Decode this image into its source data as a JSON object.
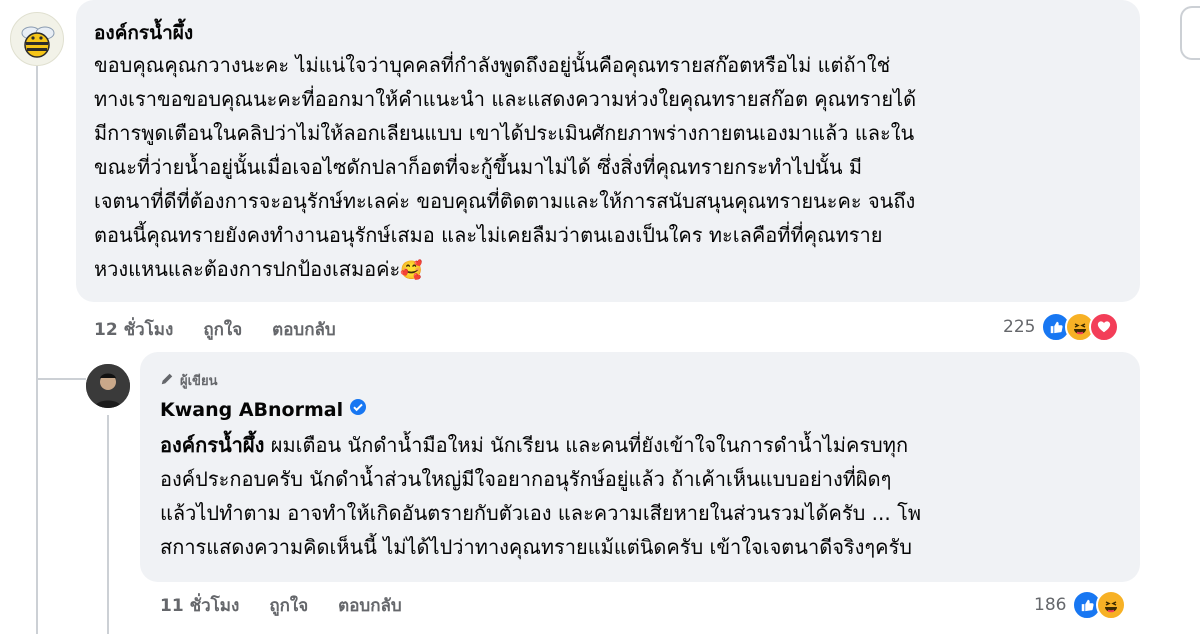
{
  "comment": {
    "author": "องค์กรน้ำผึ้ง",
    "lines": [
      "ขอบคุณคุณกวางนะคะ ไม่แน่ใจว่าบุคคลที่กำลังพูดถึงอยู่นั้นคือคุณทรายสก๊อตหรือไม่ แต่ถ้าใช่",
      "ทางเราขอขอบคุณนะคะที่ออกมาให้คำแนะนำ และแสดงความห่วงใยคุณทรายสก๊อต คุณทรายได้",
      "มีการพูดเตือนในคลิปว่าไม่ให้ลอกเลียนแบบ เขาได้ประเมินศักยภาพร่างกายตนเองมาแล้ว และใน",
      "ขณะที่ว่ายน้ำอยู่นั้นเมื่อเจอไซดักปลาก็อตที่จะกู้ขึ้นมาไม่ได้ ซึ่งสิ่งที่คุณทรายกระทำไปนั้น มี",
      "เจตนาที่ดีที่ต้องการจะอนุรักษ์ทะเลค่ะ ขอบคุณที่ติดตามและให้การสนับสนุนคุณทรายนะคะ จนถึง",
      "ตอนนี้คุณทรายยังคงทำงานอนุรักษ์เสมอ และไม่เคยลืมว่าตนเองเป็นใคร ทะเลคือที่ที่คุณทราย",
      "หวงแหนและต้องการปกป้องเสมอค่ะ"
    ],
    "trailing_emoji": "🥰",
    "time": "12 ชั่วโมง",
    "like_label": "ถูกใจ",
    "reply_label": "ตอบกลับ",
    "reaction_count": "225",
    "reactions": [
      "like",
      "haha",
      "love"
    ]
  },
  "reply": {
    "role_label": "ผู้เขียน",
    "author": "Kwang ABnormal",
    "verified": true,
    "mention": "องค์กรน้ำผึ้ง",
    "first_line_rest": " ผมเตือน นักดำน้ำมือใหม่ นักเรียน และคนที่ยังเข้าใจในการดำน้ำไม่ครบทุก",
    "lines": [
      "องค์ประกอบครับ นักดำน้ำส่วนใหญ่มีใจอยากอนุรักษ์อยู่แล้ว ถ้าเค้าเห็นแบบอย่างที่ผิดๆ",
      "แล้วไปทำตาม อาจทำให้เกิดอันตรายกับตัวเอง และความเสียหายในส่วนรวมได้ครับ ... โพ",
      "สการแสดงความคิดเห็นนี้ ไม่ได้ไปว่าทางคุณทรายแม้แต่นิดครับ เข้าใจเจตนาดีจริงๆครับ"
    ],
    "time": "11 ชั่วโมง",
    "like_label": "ถูกใจ",
    "reply_label": "ตอบกลับ",
    "reaction_count": "186",
    "reactions": [
      "like",
      "haha"
    ]
  },
  "colors": {
    "bubble_bg": "#f0f2f5",
    "meta_text": "#65676b",
    "like_blue": "#1877f2",
    "haha_yellow": "#f7b125",
    "love_red": "#f33e58",
    "verified_blue": "#1877f2"
  },
  "icons": {
    "bee_avatar": "bee-avatar-icon",
    "user_avatar": "user-avatar-icon",
    "pencil": "pencil-icon",
    "verified": "verified-badge-icon",
    "like": "like-icon",
    "haha": "haha-icon",
    "love": "love-icon"
  }
}
